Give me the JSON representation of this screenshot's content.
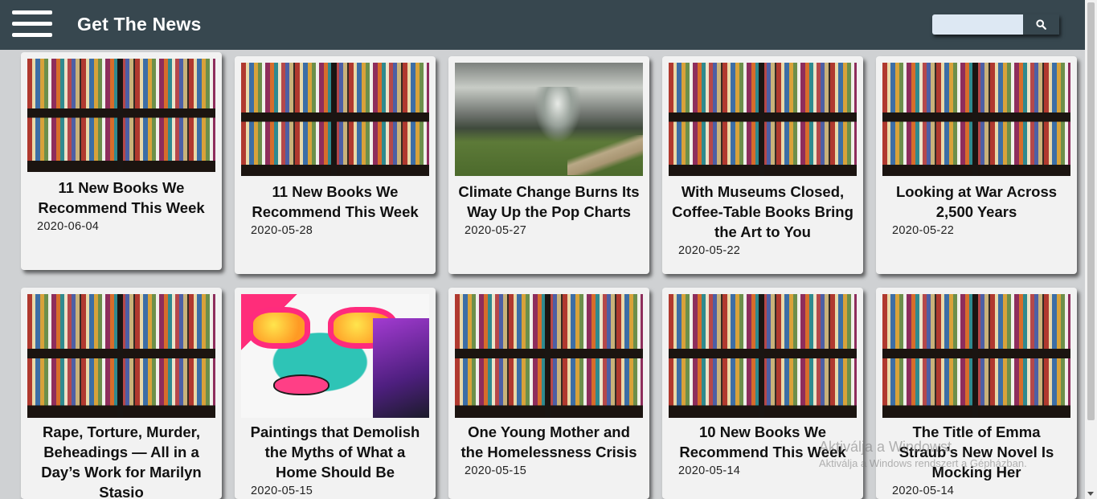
{
  "header": {
    "brand": "Get The News",
    "search_placeholder": ""
  },
  "icons": {
    "menu": "hamburger-menu-icon",
    "search": "search-icon"
  },
  "colors": {
    "navbar": "#37474f",
    "card_background": "#f2f2f2",
    "page_background": "#cfd1d3"
  },
  "articles": [
    {
      "title": "11 New Books We Recommend This Week",
      "date": "2020-06-04",
      "image": "bookshelf"
    },
    {
      "title": "11 New Books We Recommend This Week",
      "date": "2020-05-28",
      "image": "bookshelf"
    },
    {
      "title": "Climate Change Burns Its Way Up the Pop Charts",
      "date": "2020-05-27",
      "image": "storm"
    },
    {
      "title": "With Museums Closed, Coffee-Table Books Bring the Art to You",
      "date": "2020-05-22",
      "image": "bookshelf"
    },
    {
      "title": "Looking at War Across 2,500 Years",
      "date": "2020-05-22",
      "image": "bookshelf"
    },
    {
      "title": "Rape, Torture, Murder, Beheadings — All in a Day’s Work for Marilyn Stasio",
      "date": "",
      "image": "bookshelf"
    },
    {
      "title": "Paintings that Demolish the Myths of What a Home Should Be",
      "date": "2020-05-15",
      "image": "graffiti"
    },
    {
      "title": "One Young Mother and the Homelessness Crisis",
      "date": "2020-05-15",
      "image": "bookshelf"
    },
    {
      "title": "10 New Books We Recommend This Week",
      "date": "2020-05-14",
      "image": "bookshelf"
    },
    {
      "title": "The Title of Emma Straub’s New Novel Is Mocking Her",
      "date": "2020-05-14",
      "image": "bookshelf"
    }
  ],
  "watermark": {
    "line1": "Aktiválja a Windowst",
    "line2": "Aktiválja a Windows rendszert a Gépházban."
  }
}
